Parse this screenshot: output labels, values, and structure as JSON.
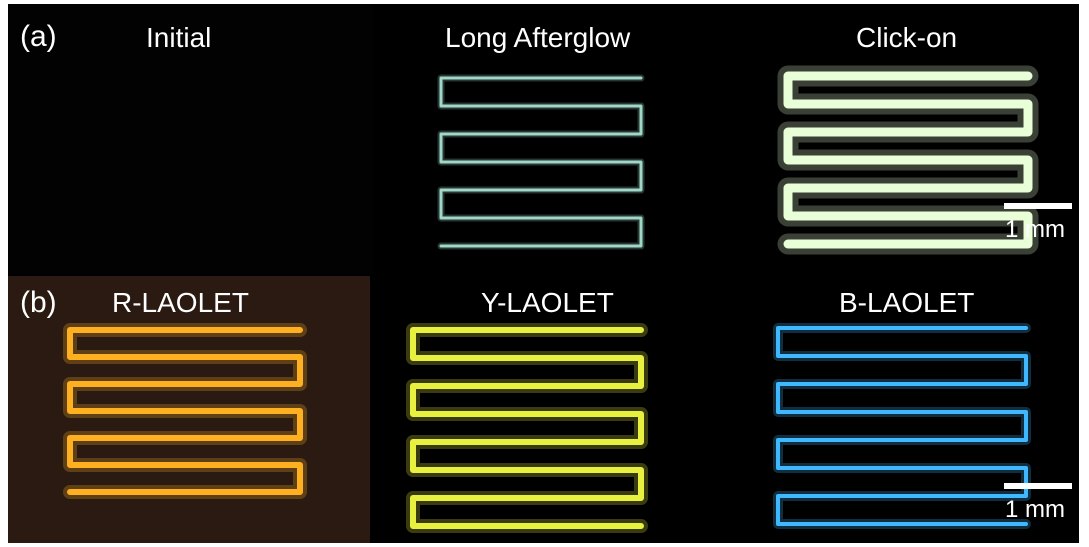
{
  "row_a": {
    "letter": "(a)",
    "panels": [
      {
        "label": "Initial",
        "color": ""
      },
      {
        "label": "Long Afterglow",
        "color": "#9fd8c8"
      },
      {
        "label": "Click-on",
        "color": "#e8ffd8"
      }
    ],
    "scalebar_label": "1 mm"
  },
  "row_b": {
    "letter": "(b)",
    "panels": [
      {
        "label": "R-LAOLET",
        "color": "#ffb020"
      },
      {
        "label": "Y-LAOLET",
        "color": "#e8f040"
      },
      {
        "label": "B-LAOLET",
        "color": "#40b8ff"
      }
    ],
    "scalebar_label": "1 mm"
  },
  "colors": {
    "background": "#000000",
    "red_panel_bg": "#2a1a12",
    "text": "#ffffff"
  }
}
